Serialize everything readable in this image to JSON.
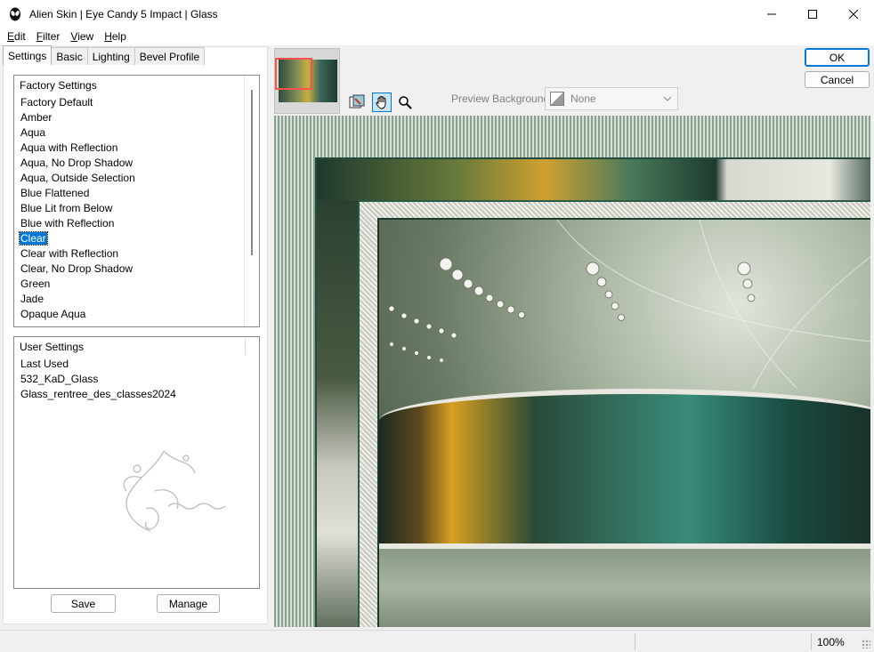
{
  "window": {
    "title": "Alien Skin | Eye Candy 5 Impact | Glass",
    "icon": "alien-skin-icon"
  },
  "menu": [
    {
      "label": "Edit",
      "mnemonic": "E",
      "rest": "dit"
    },
    {
      "label": "Filter",
      "mnemonic": "F",
      "rest": "ilter"
    },
    {
      "label": "View",
      "mnemonic": "V",
      "rest": "iew"
    },
    {
      "label": "Help",
      "mnemonic": "H",
      "rest": "elp"
    }
  ],
  "tabs": [
    "Settings",
    "Basic",
    "Lighting",
    "Bevel Profile"
  ],
  "active_tab": "Settings",
  "factory": {
    "header": "Factory Settings",
    "items": [
      "Factory Default",
      "Amber",
      "Aqua",
      "Aqua with Reflection",
      "Aqua, No Drop Shadow",
      "Aqua, Outside Selection",
      "Blue Flattened",
      "Blue Lit from Below",
      "Blue with Reflection",
      "Clear",
      "Clear with Reflection",
      "Clear, No Drop Shadow",
      "Green",
      "Jade",
      "Opaque Aqua"
    ],
    "selected": "Clear"
  },
  "user": {
    "header": "User Settings",
    "items": [
      "Last Used",
      "532_KaD_Glass",
      "Glass_rentree_des_classes2024"
    ]
  },
  "buttons": {
    "save": "Save",
    "manage": "Manage",
    "ok": "OK",
    "cancel": "Cancel"
  },
  "preview": {
    "background_label": "Preview Background:",
    "background_value": "None"
  },
  "status": {
    "zoom": "100%"
  },
  "colors": {
    "selection": "#0078d7",
    "ok_border": "#0078d7"
  }
}
